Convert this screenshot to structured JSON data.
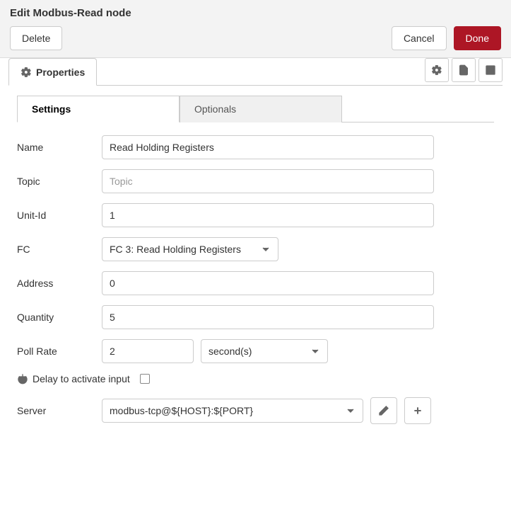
{
  "header": {
    "title": "Edit Modbus-Read node",
    "delete_label": "Delete",
    "cancel_label": "Cancel",
    "done_label": "Done"
  },
  "main_tab": {
    "properties_label": "Properties"
  },
  "sub_tabs": {
    "settings": "Settings",
    "optionals": "Optionals"
  },
  "form": {
    "name": {
      "label": "Name",
      "value": "Read Holding Registers"
    },
    "topic": {
      "label": "Topic",
      "placeholder": "Topic",
      "value": ""
    },
    "unit_id": {
      "label": "Unit-Id",
      "value": "1"
    },
    "fc": {
      "label": "FC",
      "selected": "FC 3: Read Holding Registers"
    },
    "address": {
      "label": "Address",
      "value": "0"
    },
    "quantity": {
      "label": "Quantity",
      "value": "5"
    },
    "poll_rate": {
      "label": "Poll Rate",
      "value": "2",
      "unit": "second(s)"
    },
    "delay": {
      "label": "Delay to activate input",
      "checked": false
    },
    "server": {
      "label": "Server",
      "selected": "modbus-tcp@${HOST}:${PORT}"
    }
  }
}
